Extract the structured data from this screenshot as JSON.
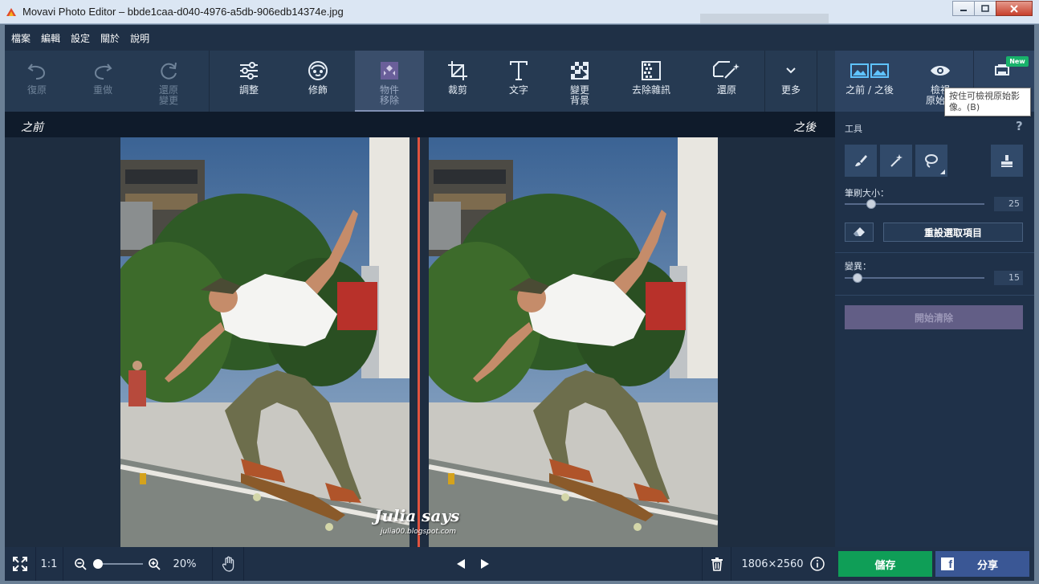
{
  "window": {
    "title": "Movavi Photo Editor – bbde1caa-d040-4976-a5db-906edb14374e.jpg"
  },
  "menu": [
    "檔案",
    "編輯",
    "設定",
    "關於",
    "說明"
  ],
  "toolbar": {
    "undo": "復原",
    "redo": "重做",
    "restore_changes": [
      "還原",
      "變更"
    ],
    "adjust": "調整",
    "retouch": "修飾",
    "object_removal": [
      "物件",
      "移除"
    ],
    "crop": "裁剪",
    "text": "文字",
    "change_background": [
      "變更",
      "背景"
    ],
    "denoise": "去除雜訊",
    "restore": "還原",
    "more": "更多",
    "before_after": "之前 / 之後",
    "view_original": [
      "檢視",
      "原始影"
    ],
    "new_badge": "New"
  },
  "tooltip": [
    "按住可檢視原始影",
    "像。(B)"
  ],
  "compare": {
    "before": "之前",
    "after": "之後"
  },
  "watermark": {
    "title": "Julia says",
    "url": "julia00.blogspot.com"
  },
  "panel": {
    "tools_title": "工具",
    "help": "?",
    "brush_size_label": "筆刷大小：",
    "brush_size_value": "25",
    "brush_size_fraction": 0.19,
    "reset_selection": "重設選取項目",
    "variation_label": "變異：",
    "variation_value": "15",
    "variation_fraction": 0.09,
    "start_erase": "開始清除"
  },
  "bottom": {
    "ratio": "1:1",
    "zoom": "20%",
    "dimensions": "1806×2560",
    "save": "儲存",
    "share": "分享"
  },
  "colors": {
    "accent_green": "#0f9e57",
    "facebook_blue": "#3a5795",
    "split_line": "#e0533f"
  },
  "icons": [
    "undo-icon",
    "redo-icon",
    "restore-icon",
    "adjust-icon",
    "retouch-icon",
    "object-removal-icon",
    "crop-icon",
    "text-icon",
    "background-icon",
    "denoise-icon",
    "magic-wand-icon",
    "chevron-down-icon",
    "before-after-icon",
    "eye-icon",
    "brush-icon",
    "wand-icon",
    "lasso-icon",
    "stamp-icon",
    "eraser-icon",
    "fullscreen-icon",
    "zoom-out-icon",
    "zoom-in-icon",
    "hand-icon",
    "prev-icon",
    "next-icon",
    "trash-icon",
    "info-icon",
    "facebook-icon"
  ]
}
